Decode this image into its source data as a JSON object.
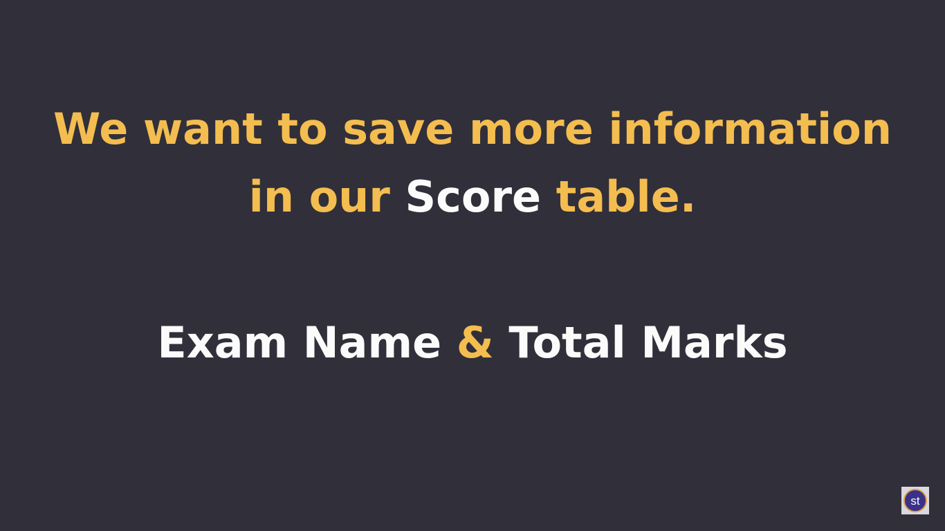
{
  "slide": {
    "headline": {
      "line1": "We want to save more information",
      "line2_pre": "in our ",
      "line2_highlight": "Score",
      "line2_post": " table."
    },
    "subline": {
      "part1": "Exam Name ",
      "ampersand": "&",
      "part2": " Total Marks"
    },
    "logo": {
      "text": "st"
    }
  },
  "colors": {
    "background": "#312f3a",
    "accent": "#f4bd50",
    "text": "#fbfbfb"
  }
}
